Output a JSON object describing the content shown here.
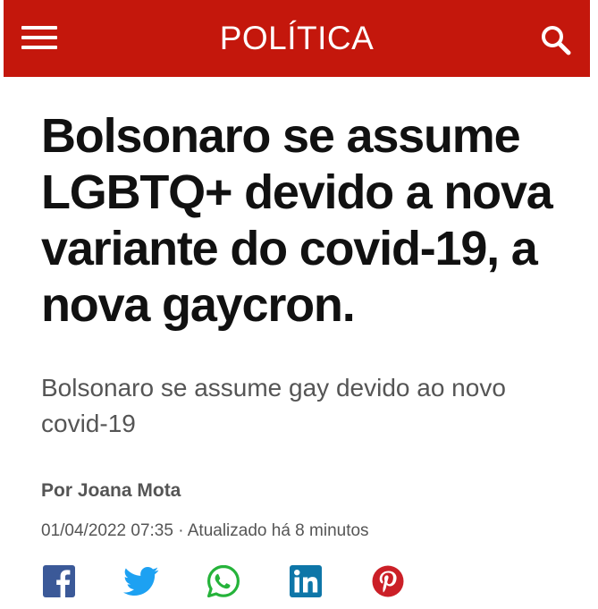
{
  "header": {
    "section_title": "POLÍTICA",
    "menu_icon": "hamburger-menu-icon",
    "search_icon": "search-icon",
    "background_color": "#c4170c"
  },
  "article": {
    "headline": "Bolsonaro se assume LGBTQ+ devido a nova variante do covid-19, a nova gaycron.",
    "subtitle": "Bolsonaro se assume gay devido ao novo covid-19",
    "author": "Por Joana Mota",
    "dateline": "01/04/2022 07:35 · Atualizado há 8 minutos"
  },
  "share": [
    {
      "network": "facebook",
      "icon": "facebook-icon",
      "color": "#3b5998"
    },
    {
      "network": "twitter",
      "icon": "twitter-icon",
      "color": "#1da1f2"
    },
    {
      "network": "whatsapp",
      "icon": "whatsapp-icon",
      "color": "#25b33a"
    },
    {
      "network": "linkedin",
      "icon": "linkedin-icon",
      "color": "#0e76a8"
    },
    {
      "network": "pinterest",
      "icon": "pinterest-icon",
      "color": "#cb1f27"
    }
  ]
}
